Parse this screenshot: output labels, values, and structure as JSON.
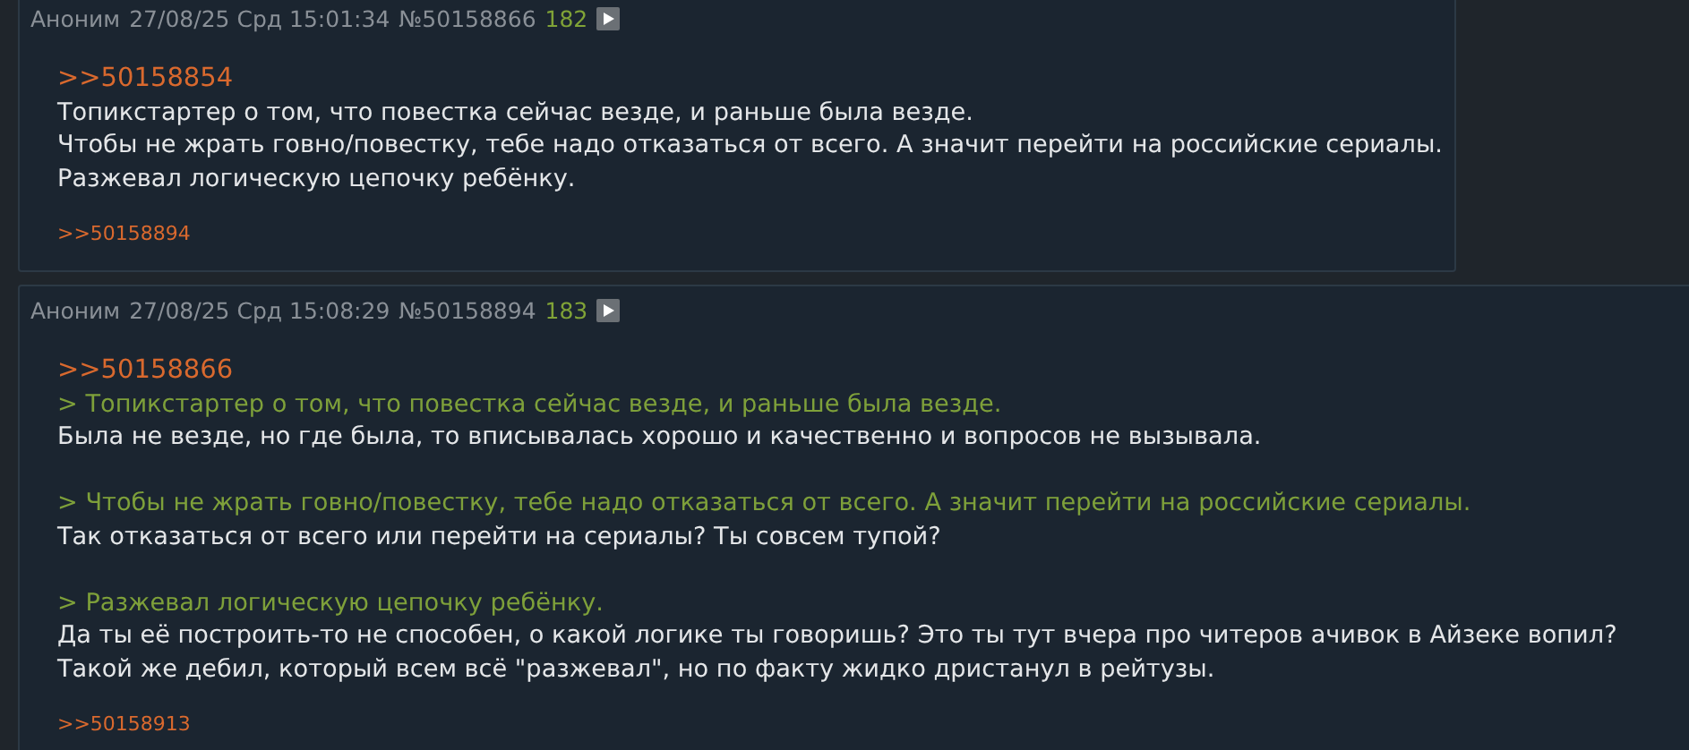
{
  "posts": [
    {
      "name": "Аноним",
      "date": "27/08/25 Срд 15:01:34",
      "number": "№50158866",
      "count": "182",
      "paragraphs": [
        [
          {
            "kind": "reply",
            "text": ">>50158854"
          },
          {
            "kind": "text",
            "text": "Топикстартер о том, что повестка сейчас везде, и раньше была везде."
          },
          {
            "kind": "text",
            "text": "Чтобы не жрать говно/повестку, тебе надо отказаться от всего. А значит перейти на российские сериалы."
          },
          {
            "kind": "text",
            "text": "Разжевал логическую цепочку ребёнку."
          }
        ]
      ],
      "backlinks": [
        ">>50158894"
      ]
    },
    {
      "name": "Аноним",
      "date": "27/08/25 Срд 15:08:29",
      "number": "№50158894",
      "count": "183",
      "paragraphs": [
        [
          {
            "kind": "reply",
            "text": ">>50158866"
          },
          {
            "kind": "quote",
            "text": "> Топикстартер о том, что повестка сейчас везде, и раньше была везде."
          },
          {
            "kind": "text",
            "text": "Была не везде, но где была, то вписывалась хорошо и качественно и вопросов не вызывала."
          }
        ],
        [
          {
            "kind": "quote",
            "text": "> Чтобы не жрать говно/повестку, тебе надо отказаться от всего. А значит перейти на российские сериалы."
          },
          {
            "kind": "text",
            "text": "Так отказаться от всего или перейти на сериалы? Ты совсем тупой?"
          }
        ],
        [
          {
            "kind": "quote",
            "text": "> Разжевал логическую цепочку ребёнку."
          },
          {
            "kind": "text",
            "text": "Да ты её построить-то не способен, о какой логике ты говоришь? Это ты тут вчера про читеров ачивок в Айзеке вопил? Такой же дебил, который всем всё \"разжевал\", но по факту жидко дристанул в рейтузы."
          }
        ]
      ],
      "backlinks": [
        ">>50158913"
      ]
    }
  ]
}
